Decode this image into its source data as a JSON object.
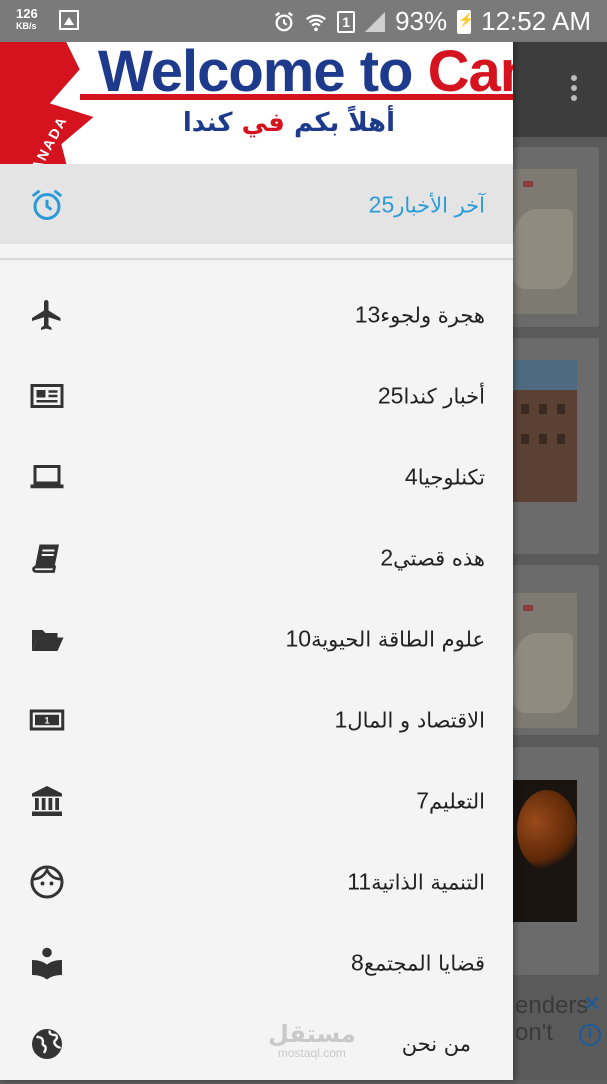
{
  "status_bar": {
    "net_speed": "126",
    "net_unit": "KB/s",
    "sim_slot": "1",
    "battery": "93%",
    "time": "12:52 AM"
  },
  "header": {
    "banner_en_prefix": "Welcome to ",
    "banner_en_country": "Canada",
    "banner_vertical": "CANADA",
    "banner_ar_part1": "أهلاً بكم ",
    "banner_ar_part2": "في ",
    "banner_ar_part3": "كندا"
  },
  "menu": {
    "items": [
      {
        "label": "آخر الأخبار",
        "count": "25",
        "icon": "alarm-clock-icon",
        "active": true
      },
      {
        "label": "هجرة ولجوء",
        "count": "13",
        "icon": "airplane-icon"
      },
      {
        "label": "أخبار كندا",
        "count": "25",
        "icon": "newspaper-icon"
      },
      {
        "label": "تكنلوجيا",
        "count": "4",
        "icon": "laptop-icon"
      },
      {
        "label": "هذه قصتي",
        "count": "2",
        "icon": "book-icon"
      },
      {
        "label": "علوم الطاقة الحيوية",
        "count": "10",
        "icon": "folder-open-icon"
      },
      {
        "label": "الاقتصاد و المال",
        "count": "1",
        "icon": "money-bill-icon"
      },
      {
        "label": "التعليم",
        "count": "7",
        "icon": "bank-building-icon"
      },
      {
        "label": "التنمية الذاتية",
        "count": "11",
        "icon": "face-icon"
      },
      {
        "label": "قضايا المجتمع",
        "count": "8",
        "icon": "reader-icon"
      },
      {
        "label": "من نحن",
        "count": "",
        "icon": "globe-icon"
      }
    ]
  },
  "watermark": {
    "ar": "مستقل",
    "en": "mostaql.com"
  },
  "background_app": {
    "ad_text_line1": "enders",
    "ad_text_line2": "on't",
    "ad_close": "✕",
    "ad_info": "i"
  },
  "colors": {
    "accent": "#2b9bd8",
    "brand_red": "#d4131f",
    "brand_blue": "#1e3a8c",
    "drawer_bg": "#f4f4f4"
  }
}
